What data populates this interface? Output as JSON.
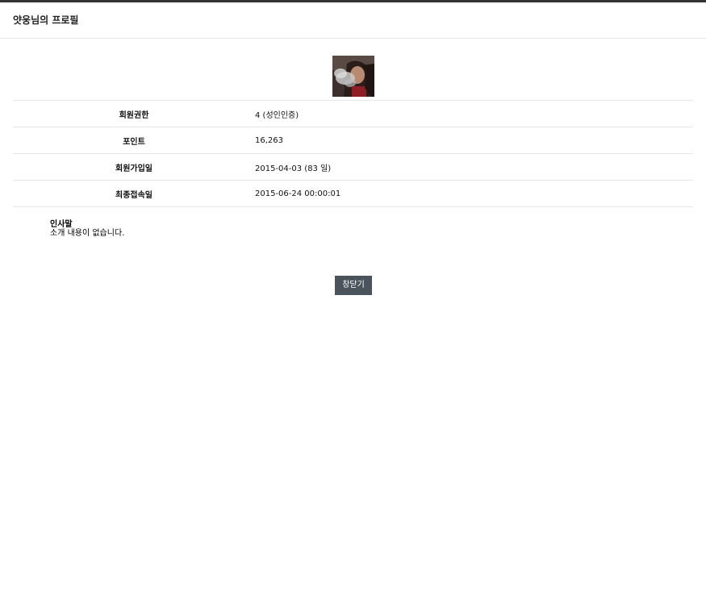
{
  "header": {
    "title": "얏웅님의 프로필"
  },
  "profile": {
    "avatar_icon": "profile-photo"
  },
  "info": {
    "rows": [
      {
        "label": "회원권한",
        "value": "4 (성인인증)"
      },
      {
        "label": "포인트",
        "value": "16,263"
      },
      {
        "label": "회원가입일",
        "value": "2015-04-03 (83 일)"
      },
      {
        "label": "최종접속일",
        "value": "2015-06-24 00:00:01"
      }
    ]
  },
  "greeting": {
    "title": "인사말",
    "body": "소개 내용이 없습니다."
  },
  "actions": {
    "close_label": "창닫기"
  },
  "colors": {
    "top_bar": "#333333",
    "button_bg": "#4b545c",
    "divider": "#e6e6e6"
  }
}
